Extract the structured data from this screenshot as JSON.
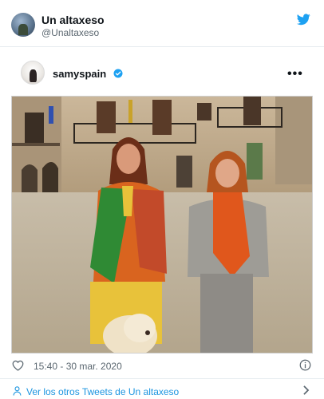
{
  "header": {
    "name": "Un altaxeso",
    "handle": "@Unaltaxeso",
    "avatar_icon": "profile-photo",
    "logo_icon": "twitter-bird-icon",
    "brand_color": "#1da1f2"
  },
  "post": {
    "author": "samyspain",
    "verified_icon": "verified-badge-icon",
    "verified_color": "#1da1f2",
    "menu_label": "•••"
  },
  "photo": {
    "description_icon": "photo-two-women-with-dog-in-plaza"
  },
  "footer": {
    "timestamp": "15:40 - 30 mar. 2020",
    "heart_icon": "heart-icon",
    "info_icon": "info-icon",
    "more_tweets": "Ver los otros Tweets de Un altaxeso",
    "link_color": "#1b95e0"
  }
}
